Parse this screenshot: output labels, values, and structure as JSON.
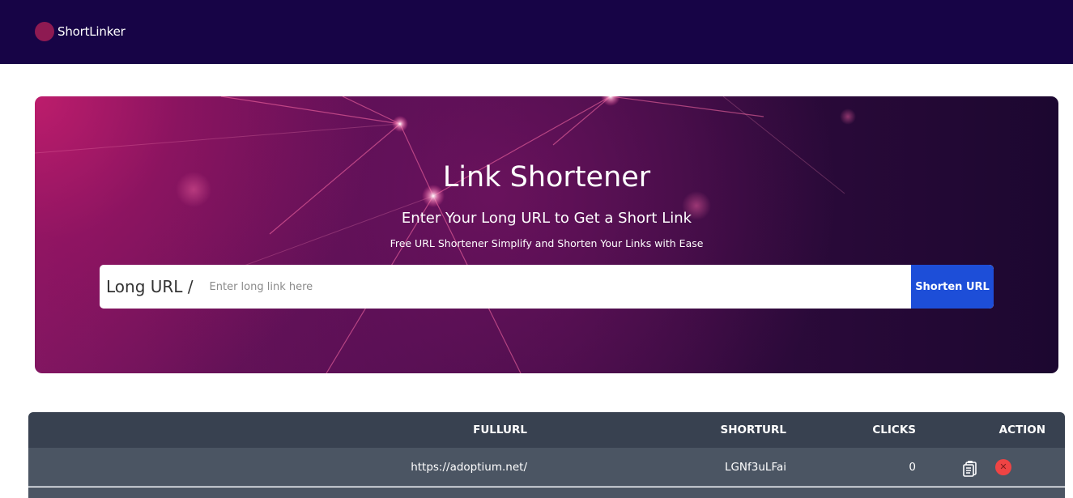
{
  "navbar": {
    "brand_name": "ShortLinker",
    "brand_color": "#8e1a52",
    "background": "#170446"
  },
  "hero": {
    "title": "Link Shortener",
    "subtitle": "Enter Your Long URL to Get a Short Link",
    "tagline": "Free URL Shortener Simplify and Shorten Your Links with Ease",
    "form": {
      "label": "Long URL /",
      "input_value": "",
      "placeholder": "Enter long link here",
      "button_label": "Shorten URL",
      "button_color": "#1d4ed8"
    }
  },
  "table": {
    "columns": [
      "FULLURL",
      "SHORTURL",
      "CLICKS",
      "ACTION"
    ],
    "rows": [
      {
        "fullurl": "https://adoptium.net/",
        "shorturl": "LGNf3uLFai",
        "clicks": "0",
        "actions": [
          "copy-icon",
          "delete-icon"
        ]
      }
    ],
    "header_color": "#384150",
    "row_color": "#4b5563"
  }
}
